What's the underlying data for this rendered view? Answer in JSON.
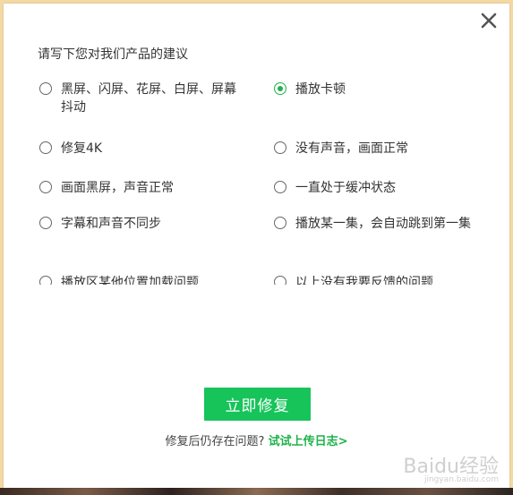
{
  "dialog": {
    "prompt": "请写下您对我们产品的建议",
    "options": [
      {
        "label": "黑屏、闪屏、花屏、白屏、屏幕抖动",
        "checked": false
      },
      {
        "label": "播放卡顿",
        "checked": true
      },
      {
        "label": "修复4K",
        "checked": false
      },
      {
        "label": "没有声音，画面正常",
        "checked": false
      },
      {
        "label": "画面黑屏，声音正常",
        "checked": false
      },
      {
        "label": "一直处于缓冲状态",
        "checked": false
      },
      {
        "label": "字幕和声音不同步",
        "checked": false
      },
      {
        "label": "播放某一集，会自动跳到第一集",
        "checked": false
      },
      {
        "label": "播放区某他位置加载问题",
        "checked": false
      },
      {
        "label": "以上没有我要反馈的问题",
        "checked": false
      }
    ],
    "repair_label": "立即修复",
    "footer_text": "修复后仍存在问题?",
    "footer_link": "试试上传日志>"
  },
  "watermark": {
    "text": "Baidu经验",
    "sub": "jingyan.baidu.com"
  },
  "colors": {
    "accent": "#16c45a",
    "link": "#1fb24b"
  }
}
